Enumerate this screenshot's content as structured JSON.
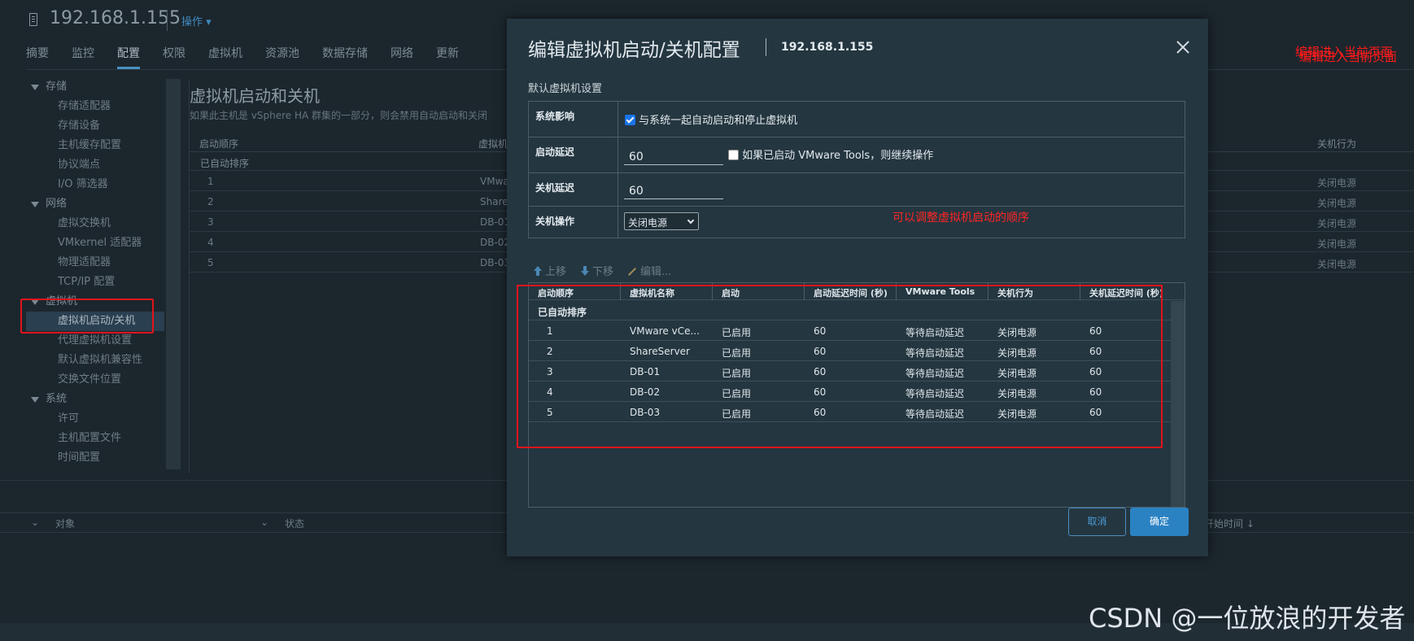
{
  "host": {
    "title": "192.168.1.155",
    "actions_label": "操作 ▾"
  },
  "tabs": [
    "摘要",
    "监控",
    "配置",
    "权限",
    "虚拟机",
    "资源池",
    "数据存储",
    "网络",
    "更新"
  ],
  "tree": {
    "storage": {
      "label": "存储",
      "items": [
        "存储适配器",
        "存储设备",
        "主机缓存配置",
        "协议端点",
        "I/O 筛选器"
      ]
    },
    "network": {
      "label": "网络",
      "items": [
        "虚拟交换机",
        "VMkernel 适配器",
        "物理适配器",
        "TCP/IP 配置"
      ]
    },
    "vm": {
      "label": "虚拟机",
      "items": [
        "虚拟机启动/关机",
        "代理虚拟机设置",
        "默认虚拟机兼容性",
        "交换文件位置"
      ]
    },
    "system": {
      "label": "系统",
      "items": [
        "许可",
        "主机配置文件",
        "时间配置"
      ]
    }
  },
  "bg": {
    "title": "虚拟机启动和关机",
    "subtitle": "如果此主机是 vSphere HA 群集的一部分，则会禁用自动启动和关闭",
    "col_order": "启动顺序",
    "col_vm": "虚拟机",
    "col_shutdown": "关机行为",
    "group": "已自动排序",
    "rows": [
      {
        "order": "1",
        "vm": "VMwa",
        "shutdown": "关闭电源"
      },
      {
        "order": "2",
        "vm": "Share",
        "shutdown": "关闭电源"
      },
      {
        "order": "3",
        "vm": "DB-01",
        "shutdown": "关闭电源"
      },
      {
        "order": "4",
        "vm": "DB-02",
        "shutdown": "关闭电源"
      },
      {
        "order": "5",
        "vm": "DB-03",
        "shutdown": "关闭电源"
      }
    ]
  },
  "tasks": {
    "col_object": "对象",
    "col_status": "状态",
    "col_start": "开始时间 ↓"
  },
  "annotations": {
    "top_right": "编辑进入当前页面",
    "middle": "可以调整虚拟机启动的顺序"
  },
  "watermark": "CSDN @一位放浪的开发者",
  "modal": {
    "title": "编辑虚拟机启动/关机配置",
    "host": "192.168.1.155",
    "section": "默认虚拟机设置",
    "settings": {
      "system_label": "系统影响",
      "system_text": "与系统一起自动启动和停止虚拟机",
      "startup_label": "启动延迟",
      "startup_value": "60",
      "startup_check_text": "如果已启动 VMware Tools，则继续操作",
      "shutdown_label": "关机延迟",
      "shutdown_value": "60",
      "action_label": "关机操作",
      "action_value": "关闭电源"
    },
    "toolbar": {
      "up": "上移",
      "down": "下移",
      "edit": "编辑..."
    },
    "columns": [
      "启动顺序",
      "虚拟机名称",
      "启动",
      "启动延迟时间 (秒)",
      "VMware Tools",
      "关机行为",
      "关机延迟时间 (秒)"
    ],
    "group": "已自动排序",
    "rows": [
      {
        "order": "1",
        "name": "VMware vCe...",
        "startup": "已启用",
        "delay": "60",
        "tools": "等待启动延迟",
        "shutdown": "关闭电源",
        "shutdown_delay": "60"
      },
      {
        "order": "2",
        "name": "ShareServer",
        "startup": "已启用",
        "delay": "60",
        "tools": "等待启动延迟",
        "shutdown": "关闭电源",
        "shutdown_delay": "60"
      },
      {
        "order": "3",
        "name": "DB-01",
        "startup": "已启用",
        "delay": "60",
        "tools": "等待启动延迟",
        "shutdown": "关闭电源",
        "shutdown_delay": "60"
      },
      {
        "order": "4",
        "name": "DB-02",
        "startup": "已启用",
        "delay": "60",
        "tools": "等待启动延迟",
        "shutdown": "关闭电源",
        "shutdown_delay": "60"
      },
      {
        "order": "5",
        "name": "DB-03",
        "startup": "已启用",
        "delay": "60",
        "tools": "等待启动延迟",
        "shutdown": "关闭电源",
        "shutdown_delay": "60"
      }
    ],
    "cancel": "取消",
    "ok": "确定"
  }
}
